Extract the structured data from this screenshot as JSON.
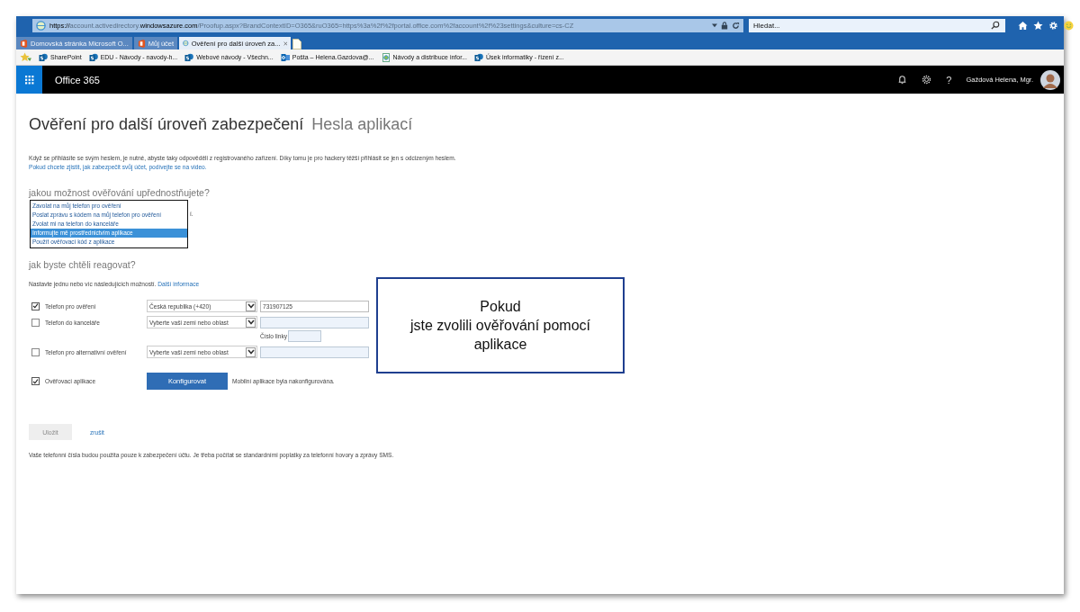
{
  "browser": {
    "url": [
      {
        "text": "https://",
        "strong": true
      },
      {
        "text": "account.activedirectory.",
        "strong": false
      },
      {
        "text": "windowsazure.com",
        "strong": true
      },
      {
        "text": "/Proofup.aspx?BrandContextID=O365&ruO365=https%3a%2f%2fportal.office.com%2faccount%2f%23settings&culture=cs-CZ",
        "strong": false
      }
    ],
    "search": {
      "placeholder": "Hledat..."
    },
    "tabs": [
      {
        "label": "Domovská stránka Microsoft O...",
        "kind": "office",
        "selected": false
      },
      {
        "label": "Můj účet",
        "kind": "office",
        "selected": false
      },
      {
        "label": "Ověření pro další úroveň za...",
        "kind": "ie",
        "selected": true
      }
    ],
    "favorites": [
      {
        "label": "SharePoint",
        "kind": "sharepoint"
      },
      {
        "label": "EDU - Návody - navody-h...",
        "kind": "sharepoint"
      },
      {
        "label": "Webové návody - Všechn...",
        "kind": "sharepoint"
      },
      {
        "label": "Pošta – Helena.Gazdova@...",
        "kind": "outlook"
      },
      {
        "label": "Návody a distribuce infor...",
        "kind": "page"
      },
      {
        "label": "Úsek informatiky - řízení z...",
        "kind": "sharepoint"
      }
    ]
  },
  "suite_bar": {
    "app_name": "Office 365",
    "help": "?",
    "user": "Gaždová Helena, Mgr."
  },
  "page": {
    "title": "Ověření pro další úroveň zabezpečení",
    "subtitle": "Hesla aplikací",
    "intro": "Když se přihlásíte se svým heslem, je nutné, abyste taky odpověděli z registrovaného zařízení. Díky tomu je pro hackery těžší přihlásit se jen s odcizeným heslem.",
    "intro_link": "Pokud chcete zjistit, jak zabezpečit svůj účet, podívejte se na video.",
    "question_1": "jakou možnost ověřování upřednostňujete?",
    "covered_text": "í.",
    "options": [
      {
        "label": "Zavolat na můj telefon pro ověření",
        "selected": false
      },
      {
        "label": "Poslat zprávu s kódem na můj telefon pro ověření",
        "selected": false
      },
      {
        "label": "Zvolat mi na telefon do kanceláře",
        "selected": false
      },
      {
        "label": "Informujte mě prostřednictvím aplikace",
        "selected": true
      },
      {
        "label": "Použít ověřovací kód z aplikace",
        "selected": false
      }
    ],
    "question_2": "jak byste chtěli reagovat?",
    "instruction": "Nastavte jednu nebo víc následujících možností.",
    "instruction_link": "Další informace",
    "methods": [
      {
        "kind": "phone",
        "label": "Telefon pro ověření",
        "checked": true,
        "country": "Česká republika (+420)",
        "number": "731907125"
      },
      {
        "kind": "phone",
        "label": "Telefon do kanceláře",
        "checked": false,
        "country": "Vyberte vaši zemi nebo oblast",
        "extension_label": "Číslo linky"
      },
      {
        "kind": "phone",
        "label": "Telefon pro alternativní ověření",
        "checked": false,
        "country": "Vyberte vaši zemi nebo oblast"
      },
      {
        "kind": "app",
        "label": "Ověřovací aplikace",
        "checked": true,
        "button": "Konfigurovat",
        "status": "Mobilní aplikace byla nakonfigurována."
      }
    ],
    "save": {
      "label": "Uložit",
      "disabled": true
    },
    "cancel": "zrušit",
    "note": "Vaše telefonní čísla budou použita pouze k zabezpečení účtu. Je třeba počítat se standardními poplatky za telefonní hovory a zprávy SMS."
  },
  "callout": {
    "lines": [
      "Pokud",
      "jste zvolili ověřování pomocí",
      "aplikace"
    ]
  }
}
